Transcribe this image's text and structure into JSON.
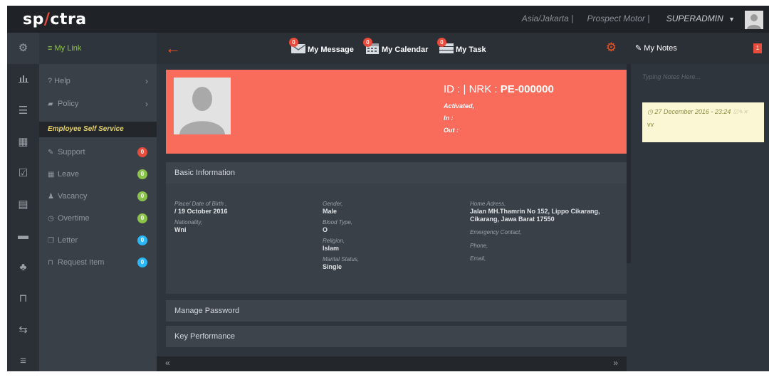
{
  "brand": {
    "left": "sp",
    "slash": "/",
    "right": "ctra"
  },
  "topbar": {
    "timezone": "Asia/Jakarta |",
    "company": "Prospect Motor |",
    "user": "SUPERADMIN"
  },
  "mylink": {
    "title": "My Link"
  },
  "menu": {
    "help": "? Help",
    "policy": "Policy",
    "section": "Employee Self Service",
    "items": [
      {
        "label": "Support",
        "count": "0",
        "color": "#e74c3c"
      },
      {
        "label": "Leave",
        "count": "0",
        "color": "#8bc34a"
      },
      {
        "label": "Vacancy",
        "count": "0",
        "color": "#8bc34a"
      },
      {
        "label": "Overtime",
        "count": "0",
        "color": "#8bc34a"
      },
      {
        "label": "Letter",
        "count": "0",
        "color": "#29b6f6"
      },
      {
        "label": "Request Item",
        "count": "0",
        "color": "#29b6f6"
      }
    ]
  },
  "quickbar": {
    "message": {
      "label": "My Message",
      "count": "0"
    },
    "calendar": {
      "label": "My Calendar",
      "count": "0"
    },
    "task": {
      "label": "My Task",
      "count": "0"
    }
  },
  "profile": {
    "id_prefix": "ID : | NRK :",
    "nrk": "PE-000000",
    "status": "Activated,",
    "in": "In :",
    "out": "Out :"
  },
  "basic": {
    "title": "Basic Information",
    "birth_label": "Place/ Date of Birth ,",
    "birth_value": "/ 19 October 2016",
    "nationality_label": "Nationality,",
    "nationality_value": "Wni",
    "gender_label": "Gender,",
    "gender_value": "Male",
    "blood_label": "Blood Type,",
    "blood_value": "O",
    "religion_label": "Religion,",
    "religion_value": "Islam",
    "marital_label": "Marital Status,",
    "marital_value": "Single",
    "address_label": "Home Adress,",
    "address_value": "Jalan MH.Thamrin No 152, Lippo Cikarang, Cikarang, Jawa Barat 17550",
    "emergency_label": "Emergency Contact,",
    "phone_label": "Phone,",
    "email_label": "Email,"
  },
  "panels": {
    "password": "Manage Password",
    "performance": "Key Performance"
  },
  "pager": {
    "prev": "«",
    "next": "»"
  },
  "notes": {
    "title": "My Notes",
    "count": "1",
    "placeholder": "Typing Notes Here...",
    "entry": {
      "date": "27 December 2016 - 23:24",
      "text": "vv"
    }
  }
}
